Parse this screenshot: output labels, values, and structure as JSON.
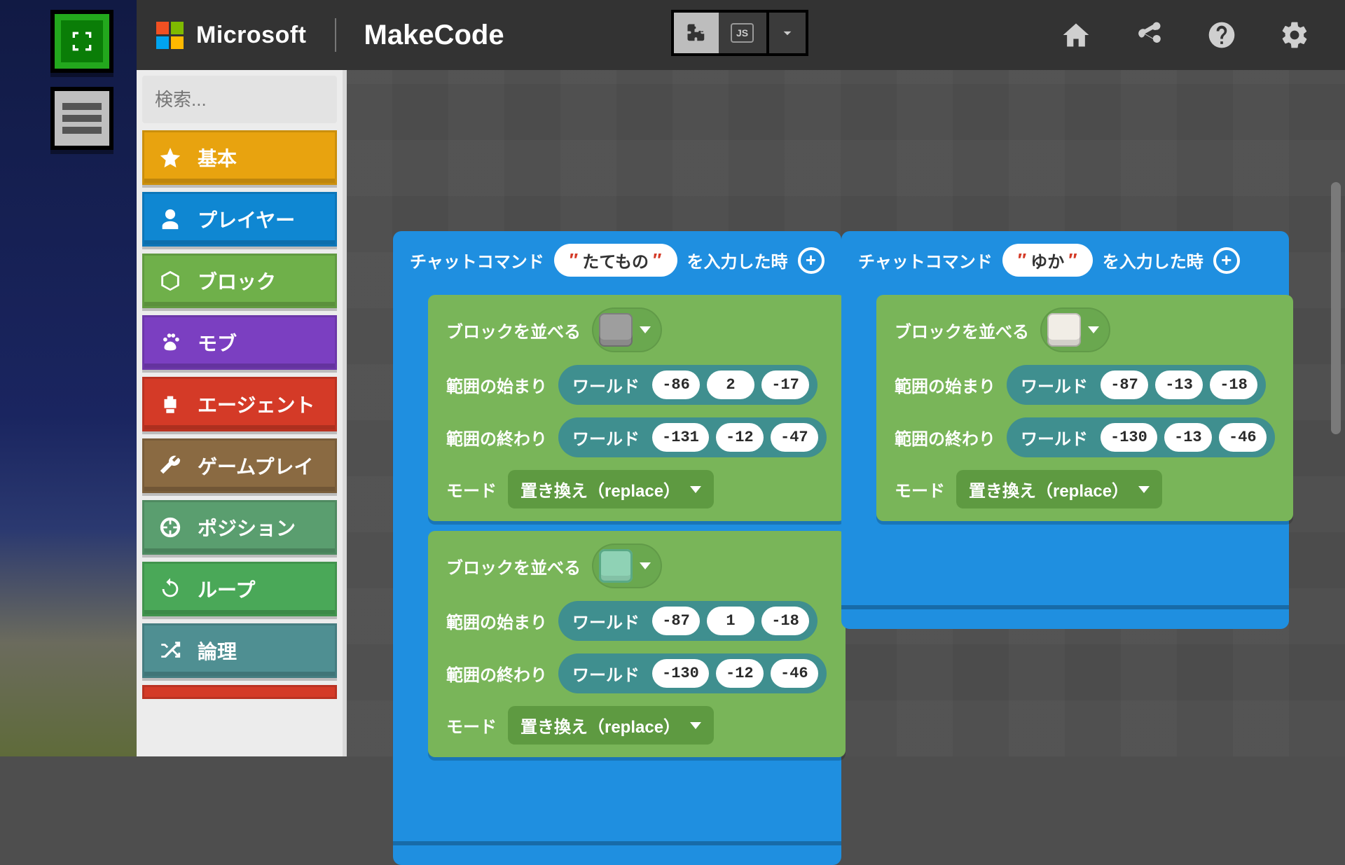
{
  "header": {
    "microsoft": "Microsoft",
    "appname": "MakeCode",
    "tabs": {
      "js": "JS"
    }
  },
  "search": {
    "placeholder": "検索..."
  },
  "categories": {
    "basic": "基本",
    "player": "プレイヤー",
    "blocks": "ブロック",
    "mobs": "モブ",
    "agent": "エージェント",
    "gameplay": "ゲームプレイ",
    "position": "ポジション",
    "loops": "ループ",
    "logic": "論理"
  },
  "labels": {
    "chat_prefix": "チャットコマンド",
    "chat_suffix": "を入力した時",
    "fill": "ブロックを並べる",
    "range_start": "範囲の始まり",
    "range_end": "範囲の終わり",
    "world": "ワールド",
    "mode": "モード",
    "replace": "置き換え（replace）"
  },
  "stacks": [
    {
      "command": "たてもの",
      "children": [
        {
          "block_icon": "stone",
          "start": {
            "x": "-86",
            "y": "2",
            "z": "-17"
          },
          "end": {
            "x": "-131",
            "y": "-12",
            "z": "-47"
          }
        },
        {
          "block_icon": "glass",
          "start": {
            "x": "-87",
            "y": "1",
            "z": "-18"
          },
          "end": {
            "x": "-130",
            "y": "-12",
            "z": "-46"
          }
        }
      ]
    },
    {
      "command": "ゆか",
      "children": [
        {
          "block_icon": "quartz",
          "start": {
            "x": "-87",
            "y": "-13",
            "z": "-18"
          },
          "end": {
            "x": "-130",
            "y": "-13",
            "z": "-46"
          }
        }
      ]
    }
  ]
}
